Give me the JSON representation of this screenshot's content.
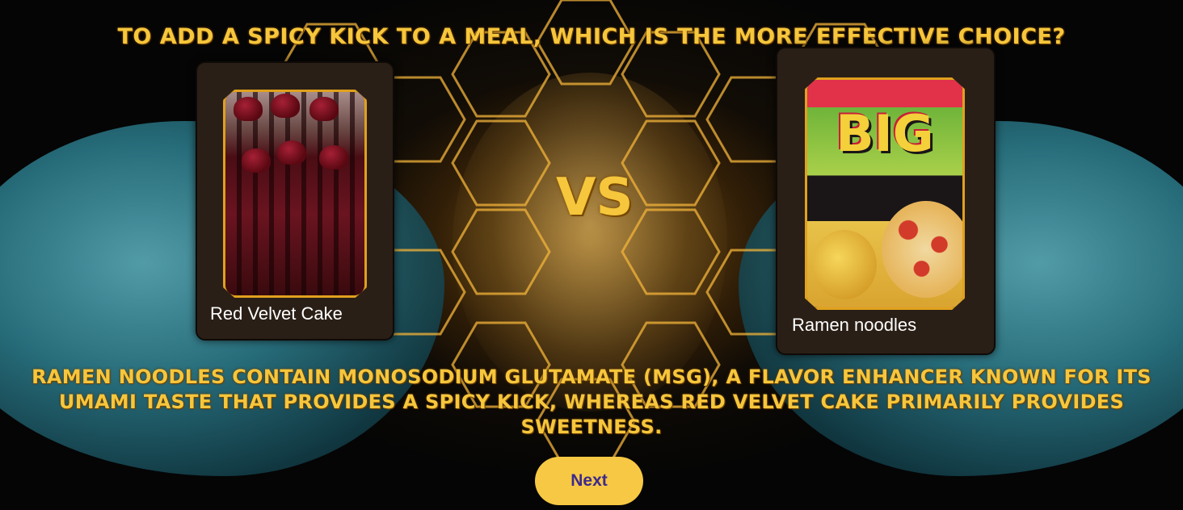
{
  "question": "To add a spicy kick to a meal, which is the more effective choice?",
  "vs_label": "VS",
  "options": [
    {
      "label": "Red Velvet Cake",
      "image": "red-velvet-cake-image"
    },
    {
      "label": "Ramen noodles",
      "image": "ramen-noodles-package-image",
      "package_text": "BIG"
    }
  ],
  "explanation": "Ramen noodles contain monosodium glutamate (MSG), a flavor enhancer known for its umami taste that provides a spicy kick, whereas Red Velvet Cake primarily provides sweetness.",
  "next_button": {
    "label": "Next"
  },
  "colors": {
    "accent_gold": "#f6c63c",
    "button_bg": "#f7c844",
    "button_text": "#3d2a8c",
    "card_bg": "#2a1f16",
    "frame_border": "#e0a11d"
  }
}
